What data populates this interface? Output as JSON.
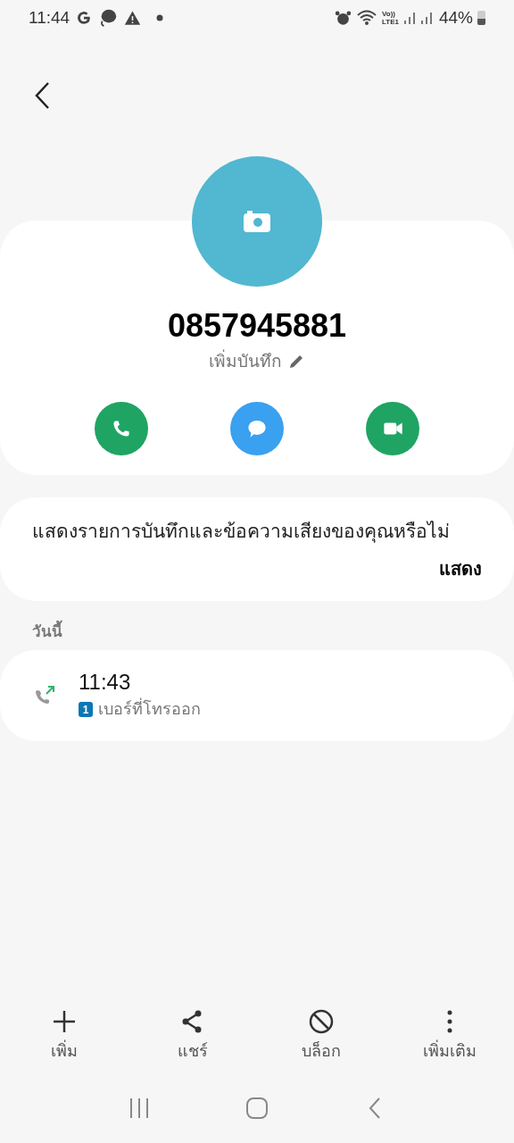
{
  "status_bar": {
    "time": "11:44",
    "volte": "Vo))",
    "lte": "LTE1",
    "battery": "44%"
  },
  "contact": {
    "number": "0857945881",
    "note_link": "เพิ่มบันทึก"
  },
  "actions": [
    {
      "kind": "call",
      "color": "#1fa463"
    },
    {
      "kind": "message",
      "color": "#3aa0f0"
    },
    {
      "kind": "video",
      "color": "#1fa463"
    }
  ],
  "recordings_prompt": {
    "text": "แสดงรายการบันทึกและข้อความเสียงของคุณหรือไม่",
    "button": "แสดง"
  },
  "history": {
    "section": "วันนี้",
    "calls": [
      {
        "kind": "outgoing",
        "time": "11:43",
        "sim": "1",
        "label": "เบอร์ที่โทรออก"
      }
    ]
  },
  "bottom_bar": [
    {
      "kind": "add",
      "label": "เพิ่ม"
    },
    {
      "kind": "share",
      "label": "แชร์"
    },
    {
      "kind": "block",
      "label": "บล็อก"
    },
    {
      "kind": "more",
      "label": "เพิ่มเติม"
    }
  ]
}
